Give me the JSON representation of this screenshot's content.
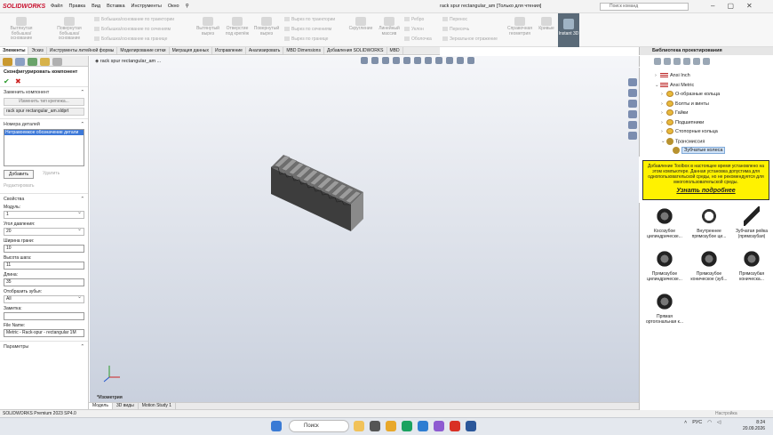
{
  "app": {
    "logo": "SOLIDWORKS",
    "document_title": "rack spur rectangular_am [Только для чтения]",
    "menus": [
      "Файл",
      "Правка",
      "Вид",
      "Вставка",
      "Инструменты",
      "Окно"
    ],
    "command_search_placeholder": "Поиск команд"
  },
  "ribbon": {
    "buttons": [
      {
        "label": "Вытянутая бобышка/основание"
      },
      {
        "label": "Повернутая бобышка/основание"
      },
      {
        "label": "Вытянутый вырез"
      },
      {
        "label": "Отверстие под крепёж"
      },
      {
        "label": "Повернутый вырез"
      },
      {
        "label": "Скругление"
      },
      {
        "label": "Линейный массив"
      },
      {
        "label": "Справочная геометрия"
      },
      {
        "label": "Кривые"
      }
    ],
    "small_items": [
      "Бобышка/основание по траектории",
      "Бобышка/основание по сечениям",
      "Бобышка/основание на границе",
      "Вырез по траектории",
      "Вырез по сечениям",
      "Вырез по границе",
      "Ребро",
      "Уклон",
      "Оболочка",
      "Перенос",
      "Пересечь",
      "Зеркальное отражение"
    ],
    "instant3d": "Instant 3D"
  },
  "command_tabs": [
    "Элементы",
    "Эскиз",
    "Инструменты литейной формы",
    "Моделирование сетки",
    "Миграция данных",
    "Исправление",
    "Анализировать",
    "MBD Dimensions",
    "Добавления SOLIDWORKS",
    "MBD"
  ],
  "left_panel": {
    "title": "Сконфигурировать компонент",
    "replace_section": "Заменить компонент",
    "change_type_button": "Изменить тип крепежа...",
    "current_file": "rack spur rectangular_am.sldprt",
    "part_numbers_section": "Номера деталей",
    "part_numbers_item": "Нетравоемкое обозначение детали",
    "add_button": "Добавить",
    "delete_button": "Удалить",
    "edit_button": "Редактировать",
    "properties_section": "Свойства",
    "module_label": "Модуль:",
    "module_value": "1",
    "pressure_angle_label": "Угол давления:",
    "pressure_angle_value": "20",
    "face_width_label": "Ширина грани:",
    "face_width_value": "10",
    "pitch_height_label": "Высота шага:",
    "pitch_height_value": "11",
    "length_label": "Длина:",
    "length_value": "35",
    "display_teeth_label": "Отобразить зубья:",
    "display_teeth_value": "All",
    "comment_label": "Заметка:",
    "comment_value": "",
    "file_name_label": "File Name:",
    "file_name_value": "Metric - Rack-spur - rectangular 1M",
    "params_section": "Параметры"
  },
  "viewport": {
    "breadcrumb": "rack spur rectangular_am ...",
    "footer_label": "*Изометрия"
  },
  "bottom_tabs": [
    "Модель",
    "3D виды",
    "Motion Study 1"
  ],
  "status_bar": {
    "text": "SOLIDWORKS Premium 2023 SP4.0",
    "right": "Настройка"
  },
  "design_library": {
    "title": "Библиотека проектирования",
    "tree": [
      {
        "label": "Ansi Inch",
        "level": 1,
        "type": "flag",
        "arrow": "›"
      },
      {
        "label": "Ansi Metric",
        "level": 1,
        "type": "flag",
        "arrow": "⌄"
      },
      {
        "label": "О-образные кольца",
        "level": 2,
        "type": "folder",
        "arrow": "›"
      },
      {
        "label": "Болты и винты",
        "level": 2,
        "type": "folder",
        "arrow": "›"
      },
      {
        "label": "Гайки",
        "level": 2,
        "type": "folder",
        "arrow": "›"
      },
      {
        "label": "Подшипники",
        "level": 2,
        "type": "folder",
        "arrow": "›"
      },
      {
        "label": "Стопорные кольца",
        "level": 2,
        "type": "folder",
        "arrow": "›"
      },
      {
        "label": "Трансмиссия",
        "level": 2,
        "type": "gear",
        "arrow": "⌄"
      },
      {
        "label": "Зубчатые колеса",
        "level": 3,
        "type": "gear",
        "arrow": ""
      }
    ],
    "message": "Добавление Toolbox в настоящее время установлено на этом компьютере. Данная установка допустима для однопользовательской среды, но не рекомендуется для многопользовательской среды.",
    "message_link": "Узнать подробнее",
    "items": [
      {
        "label": "Косозубое цилиндрическе...",
        "icon": "gear"
      },
      {
        "label": "Внутреннее прямозубое ци...",
        "icon": "ring"
      },
      {
        "label": "Зубчатая рейка (прямозубая)",
        "icon": "rack"
      },
      {
        "label": "Прямозубое цилиндрическе...",
        "icon": "gear"
      },
      {
        "label": "Прямозубое коническое (зуб...",
        "icon": "gear"
      },
      {
        "label": "Прямозубая коническа...",
        "icon": "gear"
      },
      {
        "label": "Прямая ортогональная к...",
        "icon": "gear"
      }
    ]
  },
  "taskbar": {
    "search": "Поиск",
    "lang": "РУС",
    "time": "8:24",
    "date": "20.09.2026"
  }
}
